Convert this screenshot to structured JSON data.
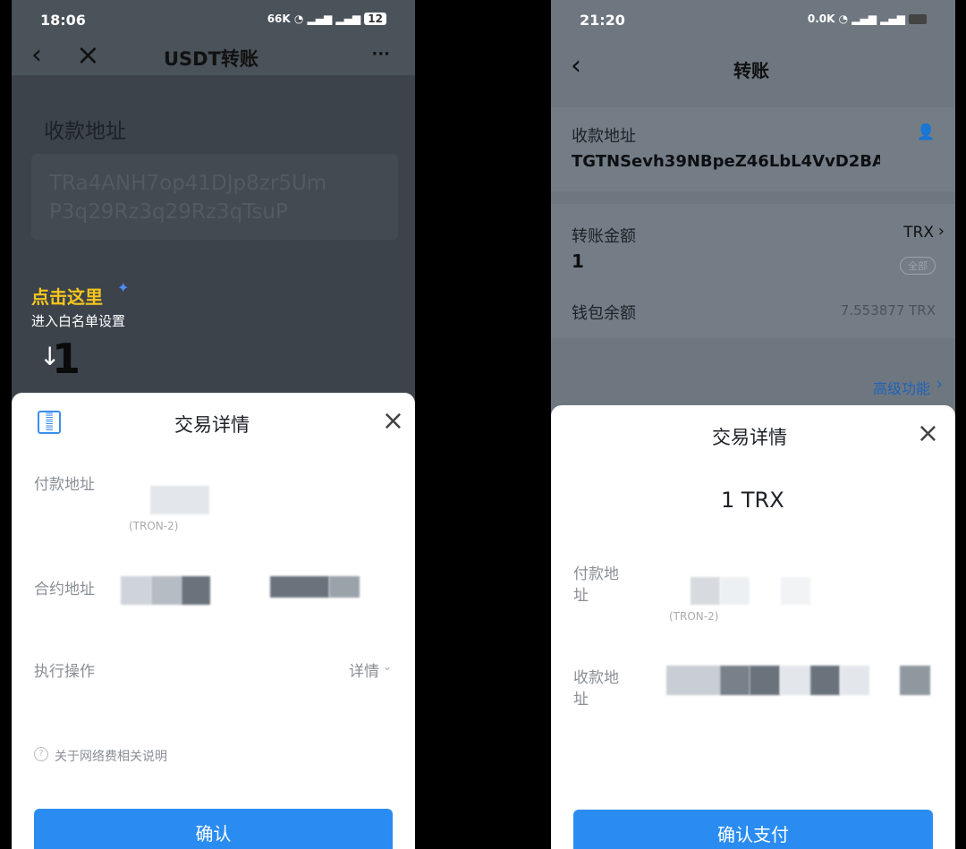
{
  "left": {
    "status": {
      "time": "18:06",
      "icons": "66K",
      "battery": "12"
    },
    "nav": {
      "back": "‹",
      "close": "×",
      "title": "USDT转账",
      "more": "···"
    },
    "address_label": "收款地址",
    "address_value_line1": "TRa4ANH7op41DJp8zr5Um",
    "address_value_line2": "P3q29Rz3q29Rz3qTsuP",
    "hint_title": "点击这里",
    "hint_sub": "进入白名单设置",
    "hint_number": "1",
    "sheet": {
      "title": "交易详情",
      "payer_label": "付款地址",
      "payer_tag": "(TRON-2)",
      "contract_label": "合约地址",
      "operation_label": "执行操作",
      "operation_value": "详情",
      "fee_note": "关于网络费相关说明",
      "confirm": "确认"
    }
  },
  "right": {
    "status": {
      "time": "21:20",
      "icons": "0.0K"
    },
    "nav": {
      "back": "‹",
      "title": "转账"
    },
    "recv_label": "收款地址",
    "recv_value": "TGTNSevh39NBpeZ46LbL4VvD2BA",
    "amount_label": "转账金额",
    "amount_currency": "TRX",
    "amount_value": "1",
    "all_btn": "全部",
    "balance_label": "钱包余额",
    "balance_value": "7.553877 TRX",
    "advanced": "高级功能",
    "sheet": {
      "title": "交易详情",
      "amount": "1 TRX",
      "payer_label_1": "付款地",
      "payer_label_2": "址",
      "payer_tag": "(TRON-2)",
      "recv_label_1": "收款地",
      "recv_label_2": "址",
      "confirm": "确认支付"
    }
  }
}
